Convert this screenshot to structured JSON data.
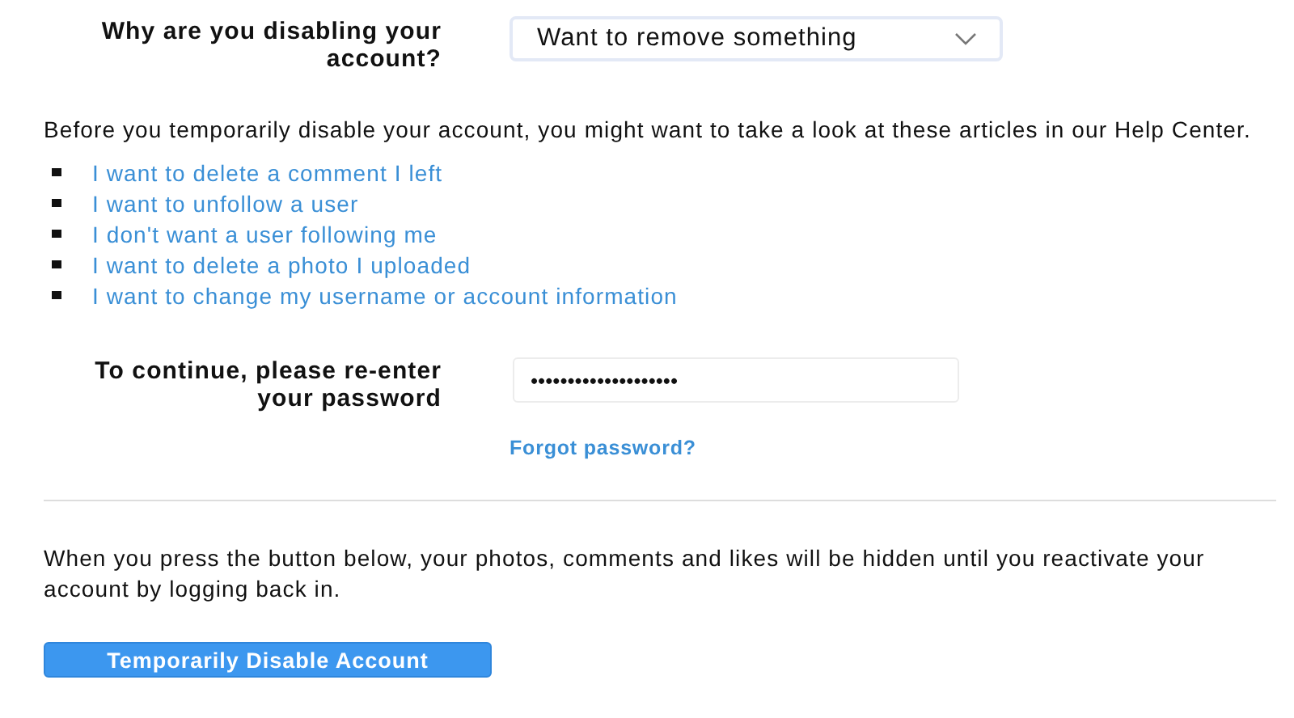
{
  "reason": {
    "label": "Why are you disabling your account?",
    "value": "Want to remove something"
  },
  "intro": "Before you temporarily disable your account, you might want to take a look at these articles in our Help Center.",
  "help_links": [
    "I want to delete a comment I left",
    "I want to unfollow a user",
    "I don't want a user following me",
    "I want to delete a photo I uploaded",
    "I want to change my username or account information"
  ],
  "password": {
    "label": "To continue, please re-enter your password",
    "value": "••••••••••••••••••••",
    "forgot_link": "Forgot password?"
  },
  "notice": "When you press the button below, your photos, comments and likes will be hidden until you reactivate your account by logging back in.",
  "button": "Temporarily Disable Account"
}
